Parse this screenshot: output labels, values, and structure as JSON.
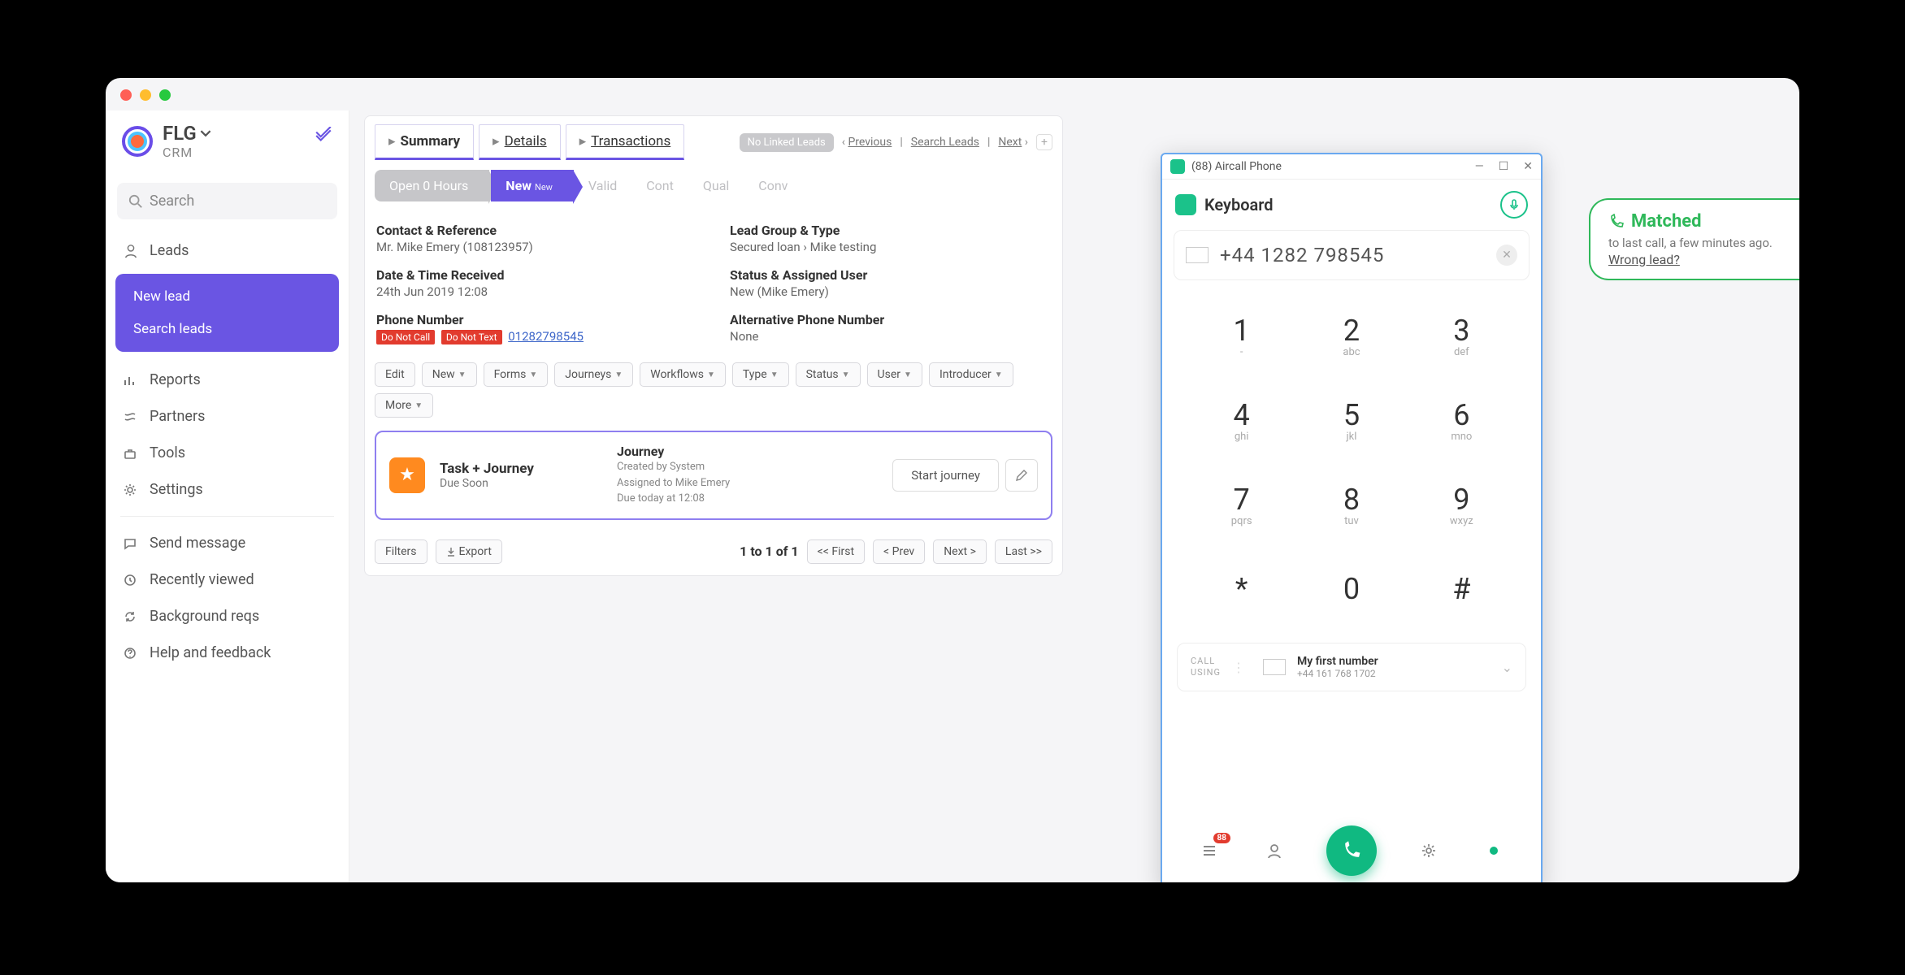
{
  "brand": {
    "name": "FLG",
    "sub": "CRM"
  },
  "search": {
    "placeholder": "Search"
  },
  "sidebar": {
    "leads": "Leads",
    "sublinks": {
      "new": "New lead",
      "search": "Search leads"
    },
    "items": [
      {
        "label": "Reports"
      },
      {
        "label": "Partners"
      },
      {
        "label": "Tools"
      },
      {
        "label": "Settings"
      }
    ],
    "extra": [
      {
        "label": "Send message"
      },
      {
        "label": "Recently viewed"
      },
      {
        "label": "Background reqs"
      },
      {
        "label": "Help and feedback"
      }
    ]
  },
  "lead": {
    "tabs": {
      "summary": "Summary",
      "details": "Details",
      "transactions": "Transactions"
    },
    "toplinks": {
      "nolinked": "No Linked Leads",
      "previous": "Previous",
      "search": "Search Leads",
      "next": "Next"
    },
    "status": {
      "open": "Open 0 Hours",
      "new": "New",
      "new_sub": "New",
      "valid": "Valid",
      "cont": "Cont",
      "qual": "Qual",
      "conv": "Conv"
    },
    "contact_ref": {
      "title": "Contact & Reference",
      "value": "Mr. Mike Emery (108123957)"
    },
    "group_type": {
      "title": "Lead Group & Type",
      "value": "Secured loan › Mike testing"
    },
    "received": {
      "title": "Date & Time Received",
      "value": "24th Jun 2019 12:08"
    },
    "assigned": {
      "title": "Status & Assigned User",
      "value": "New (Mike Emery)"
    },
    "phone": {
      "title": "Phone Number",
      "dnc": "Do Not Call",
      "dnt": "Do Not Text",
      "number": "01282798545"
    },
    "alt_phone": {
      "title": "Alternative Phone Number",
      "value": "None"
    },
    "actions": [
      "Edit",
      "New",
      "Forms",
      "Journeys",
      "Workflows",
      "Type",
      "Status",
      "User",
      "Introducer",
      "More"
    ],
    "journey": {
      "badge1": "Task + Journey",
      "badge2": "Due Soon",
      "title": "Journey",
      "l1": "Created by System",
      "l2": "Assigned to Mike Emery",
      "l3": "Due today at 12:08",
      "start": "Start journey"
    },
    "footer": {
      "filters": "Filters",
      "export": "Export",
      "range": "1 to 1 of 1",
      "first": "<< First",
      "prev": "< Prev",
      "next": "Next >",
      "last": "Last >>"
    }
  },
  "aircall": {
    "windowTitle": "(88) Aircall Phone",
    "header": "Keyboard",
    "number": "+44 1282 798545",
    "keys": [
      {
        "n": "1",
        "l": "-"
      },
      {
        "n": "2",
        "l": "abc"
      },
      {
        "n": "3",
        "l": "def"
      },
      {
        "n": "4",
        "l": "ghi"
      },
      {
        "n": "5",
        "l": "jkl"
      },
      {
        "n": "6",
        "l": "mno"
      },
      {
        "n": "7",
        "l": "pqrs"
      },
      {
        "n": "8",
        "l": "tuv"
      },
      {
        "n": "9",
        "l": "wxyz"
      },
      {
        "n": "*",
        "l": ""
      },
      {
        "n": "0",
        "l": ""
      },
      {
        "n": "#",
        "l": ""
      }
    ],
    "callusing": {
      "label": "CALL USING",
      "name": "My first number",
      "num": "+44 161 768 1702"
    },
    "badge": "88"
  },
  "matched": {
    "title": "Matched",
    "line": "to last call, a few minutes ago.",
    "link": "Wrong lead?"
  }
}
